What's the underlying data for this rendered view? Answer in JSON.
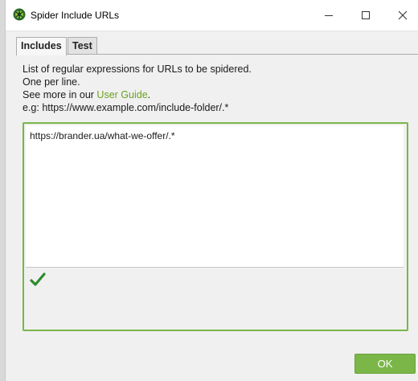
{
  "window": {
    "title": "Spider Include URLs",
    "controls": {
      "minimize": "minimize-icon",
      "maximize": "maximize-icon",
      "close": "close-icon"
    }
  },
  "tabs": [
    {
      "label": "Includes",
      "active": true
    },
    {
      "label": "Test",
      "active": false
    }
  ],
  "description": {
    "line1": "List of regular expressions for URLs to be spidered.",
    "line2": "One per line.",
    "line3_prefix": "See more in our ",
    "line3_link": "User Guide",
    "line3_suffix": ".",
    "line4": "e.g: https://www.example.com/include-folder/.*"
  },
  "editor": {
    "value": "https://brander.ua/what-we-offer/.*",
    "status_icon": "checkmark-icon",
    "status": "valid"
  },
  "buttons": {
    "ok": "OK"
  },
  "colors": {
    "accent": "#7ab648",
    "link": "#6aa121",
    "check": "#2e8b2e"
  }
}
